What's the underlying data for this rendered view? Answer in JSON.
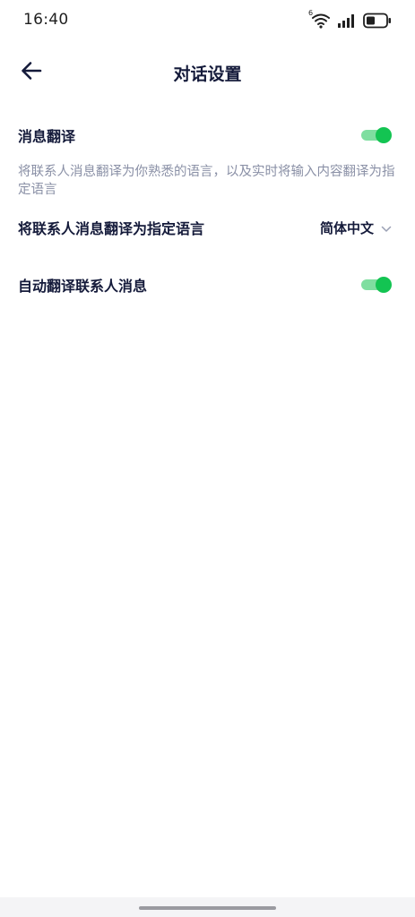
{
  "status_bar": {
    "time": "16:40",
    "wifi_badge": "6",
    "icons": [
      "wifi-icon",
      "signal-icon",
      "battery-icon"
    ],
    "battery_level": 0.45
  },
  "header": {
    "title": "对话设置",
    "back_icon": "arrow-left-icon"
  },
  "settings": {
    "message_translation": {
      "label": "消息翻译",
      "enabled": true,
      "description": "将联系人消息翻译为你熟悉的语言，以及实时将输入内容翻译为指定语言"
    },
    "target_language": {
      "label": "将联系人消息翻译为指定语言",
      "value": "简体中文",
      "icon": "chevron-down-icon"
    },
    "auto_translate": {
      "label": "自动翻译联系人消息",
      "enabled": true
    }
  },
  "colors": {
    "accent": "#13c452",
    "accent_track": "#7fdea0",
    "title_text": "#141a3a",
    "description_text": "#8a90a6"
  }
}
